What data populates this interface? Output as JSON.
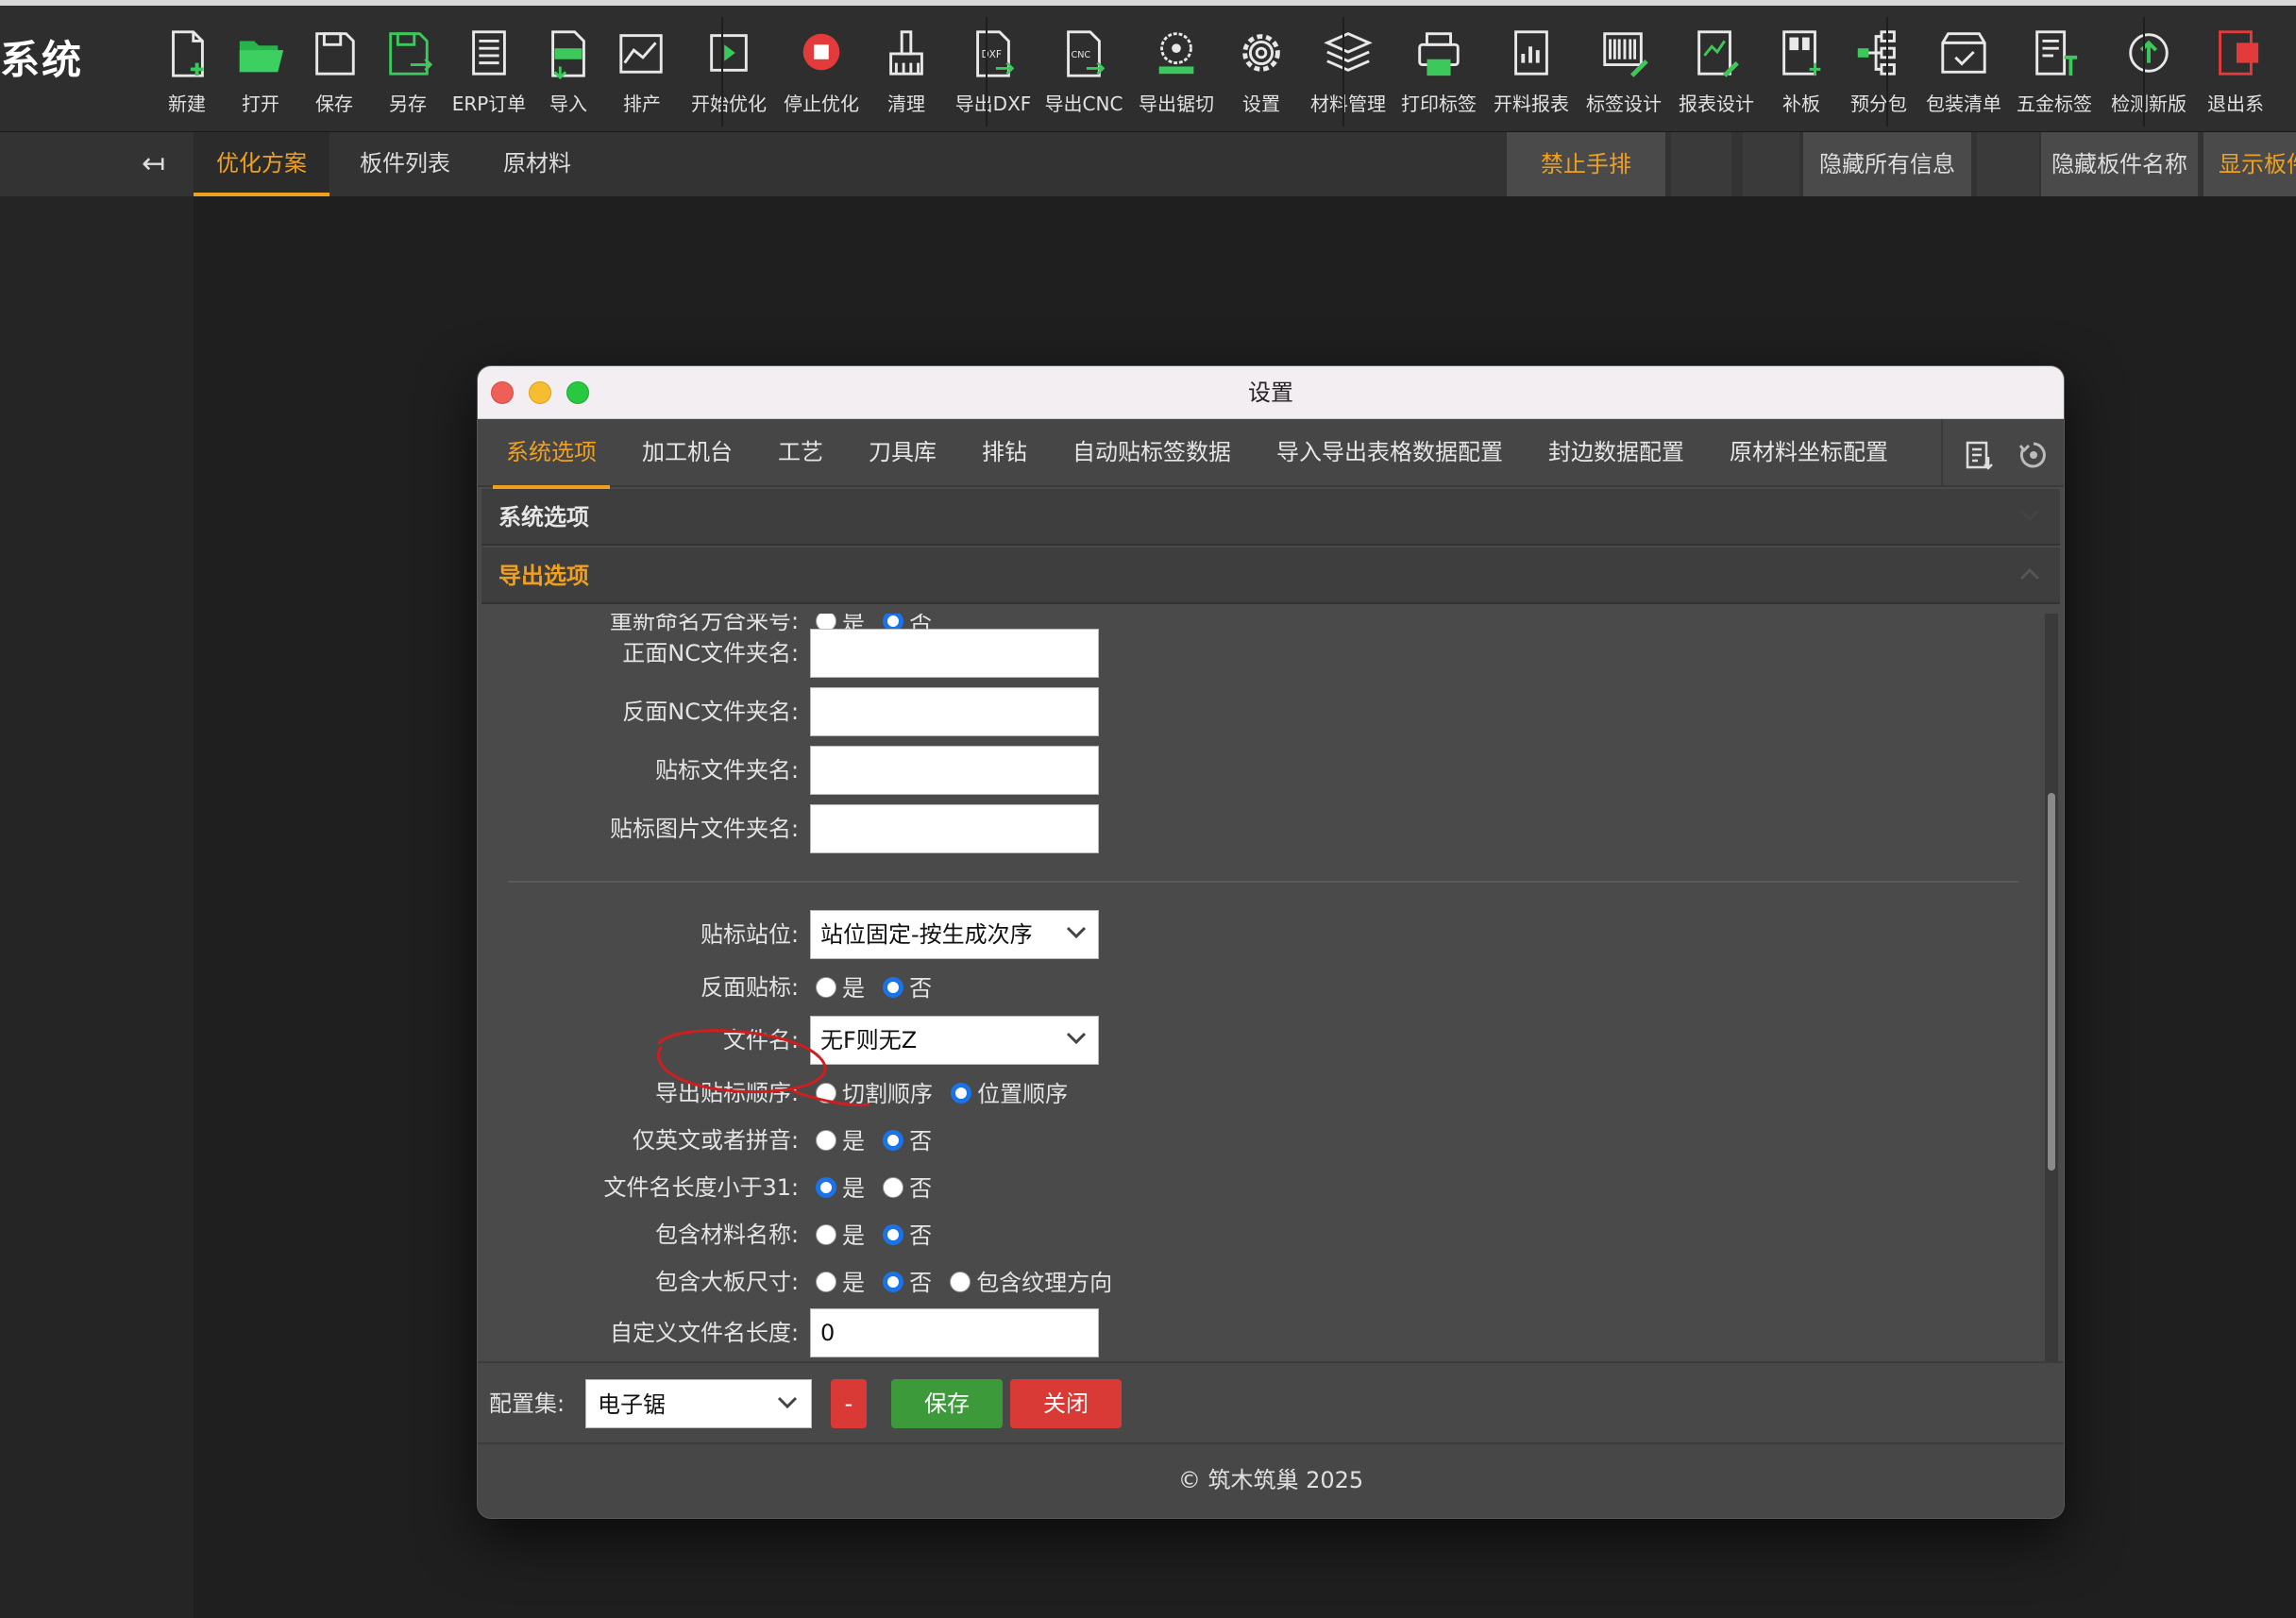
{
  "app": {
    "title": "系统"
  },
  "toolbar": {
    "items": [
      {
        "label": "新建",
        "icon": "new-file-icon"
      },
      {
        "label": "打开",
        "icon": "open-folder-icon"
      },
      {
        "label": "保存",
        "icon": "save-icon"
      },
      {
        "label": "另存",
        "icon": "save-as-icon"
      },
      {
        "label": "ERP订单",
        "icon": "erp-order-icon"
      },
      {
        "label": "导入",
        "icon": "import-xml-icon"
      },
      {
        "label": "排产",
        "icon": "schedule-icon"
      },
      {
        "label": "开始优化",
        "icon": "play-icon"
      },
      {
        "label": "停止优化",
        "icon": "stop-icon"
      },
      {
        "label": "清理",
        "icon": "broom-icon"
      },
      {
        "label": "导出DXF",
        "icon": "dxf-icon"
      },
      {
        "label": "导出CNC",
        "icon": "cnc-icon"
      },
      {
        "label": "导出锯切",
        "icon": "saw-icon"
      },
      {
        "label": "设置",
        "icon": "gear-icon"
      },
      {
        "label": "材料管理",
        "icon": "layers-icon"
      },
      {
        "label": "打印标签",
        "icon": "printer-icon"
      },
      {
        "label": "开料报表",
        "icon": "report-icon"
      },
      {
        "label": "标签设计",
        "icon": "barcode-icon"
      },
      {
        "label": "报表设计",
        "icon": "report-design-icon"
      },
      {
        "label": "补板",
        "icon": "patch-board-icon"
      },
      {
        "label": "预分包",
        "icon": "tree-icon"
      },
      {
        "label": "包装清单",
        "icon": "package-icon"
      },
      {
        "label": "五金标签",
        "icon": "hardware-label-icon"
      },
      {
        "label": "检测新版",
        "icon": "update-icon"
      },
      {
        "label": "退出系",
        "icon": "exit-icon"
      }
    ]
  },
  "subbar": {
    "tabs": [
      "优化方案",
      "板件列表",
      "原材料"
    ],
    "active_tab": 0,
    "buttons": [
      "禁止手排",
      "隐藏所有信息",
      "隐藏板件名称",
      "显示板件"
    ]
  },
  "dialog": {
    "title": "设置",
    "tabs": [
      "系统选项",
      "加工机台",
      "工艺",
      "刀具库",
      "排钻",
      "自动贴标签数据",
      "导入导出表格数据配置",
      "封边数据配置",
      "原材料坐标配置"
    ],
    "active_tab": 0,
    "sections": [
      {
        "label": "系统选项",
        "expanded": false
      },
      {
        "label": "导出选项",
        "expanded": true
      }
    ],
    "partial_row": {
      "label": "重新命名方合来号",
      "options": [
        "是",
        "否"
      ],
      "selected": 1
    },
    "text_fields": [
      {
        "label": "正面NC文件夹名",
        "value": ""
      },
      {
        "label": "反面NC文件夹名",
        "value": ""
      },
      {
        "label": "贴标文件夹名",
        "value": ""
      },
      {
        "label": "贴标图片文件夹名",
        "value": ""
      }
    ],
    "station_field": {
      "label": "贴标站位",
      "value": "站位固定-按生成次序"
    },
    "back_label": {
      "label": "反面贴标",
      "options": [
        "是",
        "否"
      ],
      "selected": 1
    },
    "filename_field": {
      "label": "文件名",
      "value": "无F则无Z"
    },
    "export_order": {
      "label": "导出贴标顺序",
      "options": [
        "切割顺序",
        "位置顺序"
      ],
      "selected": 1
    },
    "english_only": {
      "label": "仅英文或者拼音",
      "options": [
        "是",
        "否"
      ],
      "selected": 1
    },
    "name_len31": {
      "label": "文件名长度小于31",
      "options": [
        "是",
        "否"
      ],
      "selected": 0
    },
    "include_material": {
      "label": "包含材料名称",
      "options": [
        "是",
        "否"
      ],
      "selected": 1
    },
    "include_board_size": {
      "label": "包含大板尺寸",
      "options": [
        "是",
        "否",
        "包含纹理方向"
      ],
      "selected": 1
    },
    "custom_name_len": {
      "label": "自定义文件名长度",
      "value": "0"
    },
    "footer": {
      "config_label": "配置集:",
      "config_value": "电子锯",
      "minus_label": "-",
      "save_label": "保存",
      "close_label": "关闭"
    },
    "copyright": "© 筑木筑巢 2025"
  },
  "colors": {
    "accent": "#f0a020",
    "primary": "#1a73e8",
    "save": "#3c9a3a",
    "danger": "#d93a36"
  }
}
